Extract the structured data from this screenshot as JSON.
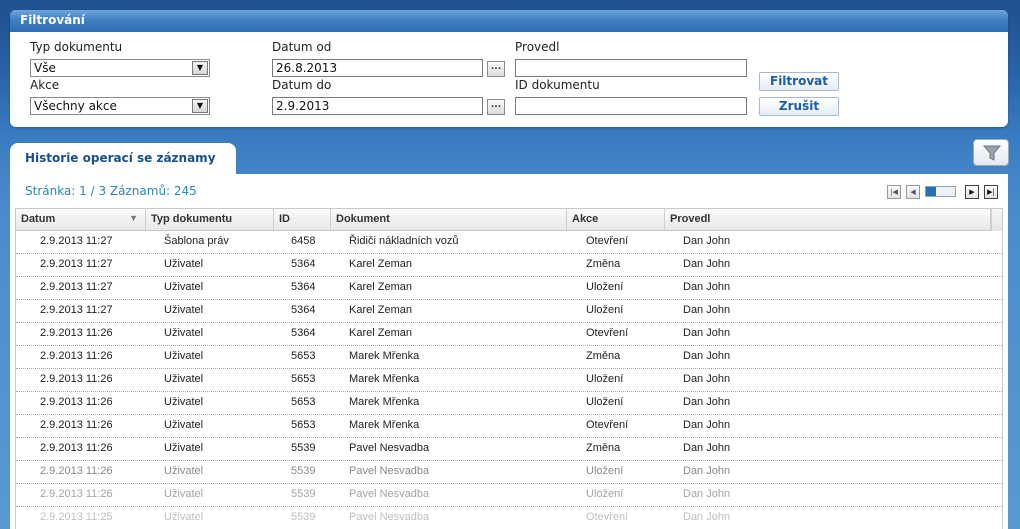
{
  "filter": {
    "title": "Filtrování",
    "doc_type_label": "Typ dokumentu",
    "doc_type_value": "Vše",
    "action_label": "Akce",
    "action_value": "Všechny akce",
    "date_from_label": "Datum od",
    "date_from_value": "26.8.2013",
    "date_to_label": "Datum do",
    "date_to_value": "2.9.2013",
    "picker_label": "...",
    "performed_by_label": "Provedl",
    "performed_by_value": "",
    "doc_id_label": "ID dokumentu",
    "doc_id_value": "",
    "filter_button": "Filtrovat",
    "cancel_button": "Zrušit"
  },
  "tab": {
    "label": "Historie operací se záznamy"
  },
  "pager": {
    "info": "Stránka: 1 / 3  Záznamů: 245",
    "current_page": 1,
    "total_pages": 3,
    "progress_fraction": 0.333
  },
  "table": {
    "columns": [
      "Datum",
      "Typ dokumentu",
      "ID",
      "Dokument",
      "Akce",
      "Provedl"
    ],
    "rows": [
      [
        "2.9.2013 11:27",
        "Šablona práv",
        "6458",
        "Řidiči nákladních vozů",
        "Otevření",
        "Dan John"
      ],
      [
        "2.9.2013 11:27",
        "Uživatel",
        "5364",
        "Karel Zeman",
        "Změna",
        "Dan John"
      ],
      [
        "2.9.2013 11:27",
        "Uživatel",
        "5364",
        "Karel Zeman",
        "Uložení",
        "Dan John"
      ],
      [
        "2.9.2013 11:27",
        "Uživatel",
        "5364",
        "Karel Zeman",
        "Uložení",
        "Dan John"
      ],
      [
        "2.9.2013 11:26",
        "Uživatel",
        "5364",
        "Karel Zeman",
        "Otevření",
        "Dan John"
      ],
      [
        "2.9.2013 11:26",
        "Uživatel",
        "5653",
        "Marek Mřenka",
        "Změna",
        "Dan John"
      ],
      [
        "2.9.2013 11:26",
        "Uživatel",
        "5653",
        "Marek Mřenka",
        "Uložení",
        "Dan John"
      ],
      [
        "2.9.2013 11:26",
        "Uživatel",
        "5653",
        "Marek Mřenka",
        "Uložení",
        "Dan John"
      ],
      [
        "2.9.2013 11:26",
        "Uživatel",
        "5653",
        "Marek Mřenka",
        "Otevření",
        "Dan John"
      ],
      [
        "2.9.2013 11:26",
        "Uživatel",
        "5539",
        "Pavel Nesvadba",
        "Změna",
        "Dan John"
      ],
      [
        "2.9.2013 11:26",
        "Uživatel",
        "5539",
        "Pavel Nesvadba",
        "Uložení",
        "Dan John"
      ],
      [
        "2.9.2013 11:26",
        "Uživatel",
        "5539",
        "Pavel Nesvadba",
        "Uložení",
        "Dan John"
      ],
      [
        "2.9.2013 11:25",
        "Uživatel",
        "5539",
        "Pavel Nesvadba",
        "Otevření",
        "Dan John"
      ]
    ]
  },
  "icons": {
    "dropdown": "chevron-down-icon",
    "filter_toggle": "funnel-icon",
    "pager_first": "first-page-icon",
    "pager_prev": "prev-page-icon",
    "pager_next": "next-page-icon",
    "pager_last": "last-page-icon",
    "sort": "sort-desc-icon"
  },
  "colors": {
    "header_blue": "#2e6eb1",
    "link_blue": "#2a86b8",
    "tab_text": "#1b4f8a"
  }
}
